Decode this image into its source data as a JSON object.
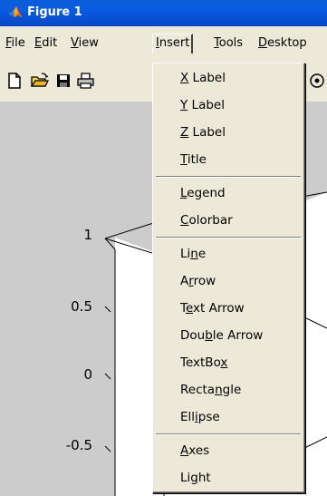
{
  "window": {
    "title": "Figure 1"
  },
  "menubar": {
    "items": [
      {
        "pre": "",
        "key": "F",
        "post": "ile"
      },
      {
        "pre": "",
        "key": "E",
        "post": "dit"
      },
      {
        "pre": "",
        "key": "V",
        "post": "iew"
      },
      {
        "pre": "",
        "key": "I",
        "post": "nsert"
      },
      {
        "pre": "",
        "key": "T",
        "post": "ools"
      },
      {
        "pre": "",
        "key": "D",
        "post": "esktop"
      }
    ]
  },
  "toolbar": {
    "icons": [
      "new-file-icon",
      "open-folder-icon",
      "save-icon",
      "print-icon",
      "rotate-3d-icon"
    ]
  },
  "insert_menu": {
    "items": [
      {
        "pre": "",
        "key": "X",
        "post": " Label"
      },
      {
        "pre": "",
        "key": "Y",
        "post": " Label"
      },
      {
        "pre": "",
        "key": "Z",
        "post": " Label"
      },
      {
        "pre": "",
        "key": "T",
        "post": "itle"
      },
      {
        "pre": "",
        "key": "L",
        "post": "egend"
      },
      {
        "pre": "",
        "key": "C",
        "post": "olorbar"
      },
      {
        "pre": "Li",
        "key": "n",
        "post": "e"
      },
      {
        "pre": "A",
        "key": "r",
        "post": "row"
      },
      {
        "pre": "T",
        "key": "e",
        "post": "xt Arrow"
      },
      {
        "pre": "Dou",
        "key": "b",
        "post": "le Arrow"
      },
      {
        "pre": "TextBo",
        "key": "x",
        "post": ""
      },
      {
        "pre": "Recta",
        "key": "n",
        "post": "gle"
      },
      {
        "pre": "Ell",
        "key": "i",
        "post": "pse"
      },
      {
        "pre": "",
        "key": "A",
        "post": "xes"
      },
      {
        "pre": "Li",
        "key": "g",
        "post": "ht"
      }
    ]
  },
  "plot": {
    "y_ticks": [
      "1",
      "0.5",
      "0",
      "-0.5"
    ]
  },
  "colors": {
    "titlebar": "#0a5ed8",
    "chrome": "#ece9d8",
    "figure_background": "#cccccc",
    "axes_face": "#ffffff"
  }
}
